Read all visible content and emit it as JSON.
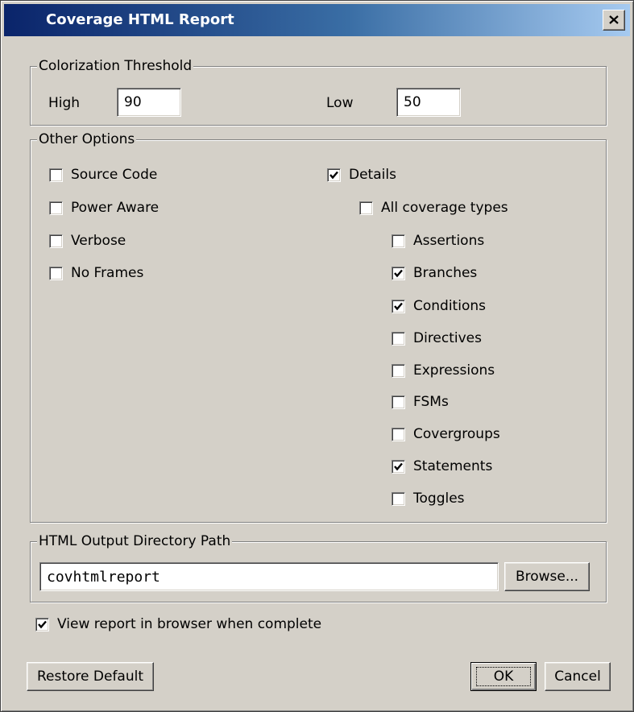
{
  "window": {
    "title": "Coverage HTML Report",
    "close_icon": "close-icon",
    "title_gradient": [
      "#0a246a",
      "#a6caf0"
    ]
  },
  "threshold": {
    "label": "Colorization Threshold",
    "high_label": "High",
    "high_value": "90",
    "low_label": "Low",
    "low_value": "50"
  },
  "other": {
    "label": "Other Options",
    "source_code": {
      "label": "Source Code",
      "checked": false
    },
    "power_aware": {
      "label": "Power Aware",
      "checked": false
    },
    "verbose": {
      "label": "Verbose",
      "checked": false
    },
    "no_frames": {
      "label": "No Frames",
      "checked": false
    },
    "details": {
      "label": "Details",
      "checked": true
    },
    "all_types": {
      "label": "All coverage types",
      "checked": false
    },
    "types": {
      "assertions": {
        "label": "Assertions",
        "checked": false
      },
      "branches": {
        "label": "Branches",
        "checked": true
      },
      "conditions": {
        "label": "Conditions",
        "checked": true
      },
      "directives": {
        "label": "Directives",
        "checked": false
      },
      "expressions": {
        "label": "Expressions",
        "checked": false
      },
      "fsms": {
        "label": "FSMs",
        "checked": false
      },
      "covergroups": {
        "label": "Covergroups",
        "checked": false
      },
      "statements": {
        "label": "Statements",
        "checked": true
      },
      "toggles": {
        "label": "Toggles",
        "checked": false
      }
    }
  },
  "output": {
    "label": "HTML Output Directory Path",
    "path_value": "covhtmlreport",
    "browse_label": "Browse..."
  },
  "view_in_browser": {
    "label": "View report in browser when complete",
    "checked": true
  },
  "buttons": {
    "restore": "Restore Default",
    "ok": "OK",
    "cancel": "Cancel"
  }
}
